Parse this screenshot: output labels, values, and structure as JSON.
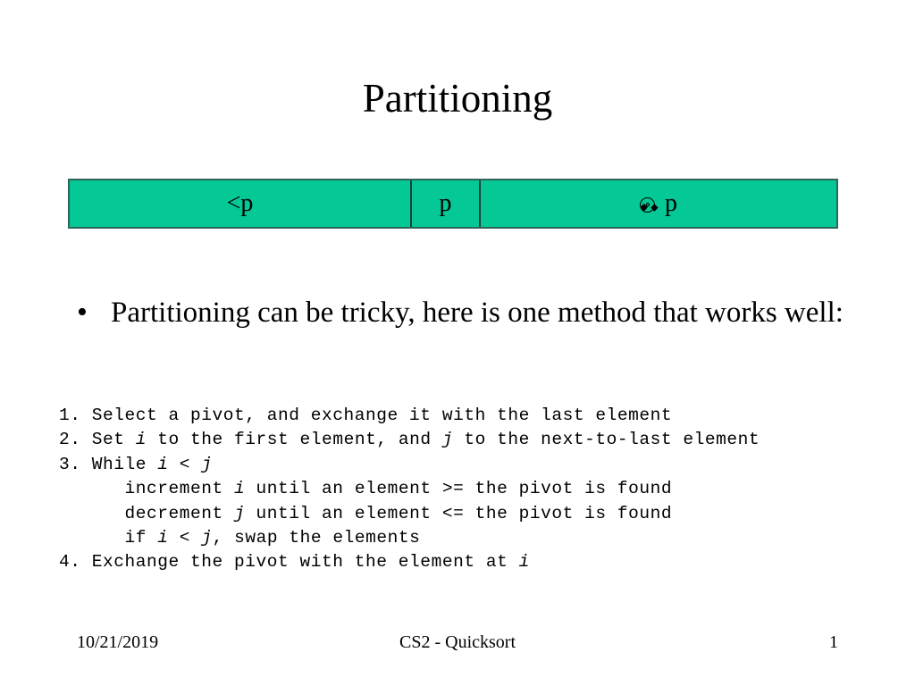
{
  "slide": {
    "title": "Partitioning",
    "theme": {
      "bar_fill": "#04C996",
      "bar_border": "#2f6659",
      "divider": "#1d3f38",
      "text": "#000000",
      "background": "#ffffff"
    }
  },
  "partition_bar": {
    "cells": [
      {
        "label": "<p",
        "icon": ""
      },
      {
        "label": "p",
        "icon": ""
      },
      {
        "label": "p",
        "icon": "disc-glyph-icon"
      }
    ]
  },
  "bullet": {
    "marker": "•",
    "text": "Partitioning can be tricky, here is one method that works well:"
  },
  "algorithm": {
    "lines": [
      {
        "prefix": "1. Select a pivot, and exchange it with the last element"
      },
      {
        "prefix": "2. Set ",
        "em1": "i",
        "mid1": " to the first element, and ",
        "em2": "j",
        "mid2": " to the next-to-last element"
      },
      {
        "prefix": "3. While ",
        "em1": "i",
        "mid1": " < ",
        "em2": "j",
        "mid2": ""
      },
      {
        "prefix": "      increment ",
        "em1": "i",
        "mid1": " until an element >= the pivot is found"
      },
      {
        "prefix": "      decrement ",
        "em1": "j",
        "mid1": " until an element <= the pivot is found"
      },
      {
        "prefix": "      if ",
        "em1": "i",
        "mid1": " < ",
        "em2": "j",
        "mid2": ", swap the elements"
      },
      {
        "prefix": "4. Exchange the pivot with the element at ",
        "em1": "i",
        "mid1": ""
      }
    ],
    "plain_text": [
      "1. Select a pivot, and exchange it with the last element",
      "2. Set i to the first element, and j to the next-to-last element",
      "3. While i < j",
      "      increment i until an element >= the pivot is found",
      "      decrement j until an element <= the pivot is found",
      "      if i < j, swap the elements",
      "4. Exchange the pivot with the element at i"
    ]
  },
  "footer": {
    "date": "10/21/2019",
    "center": "CS2 - Quicksort",
    "page": "1"
  }
}
